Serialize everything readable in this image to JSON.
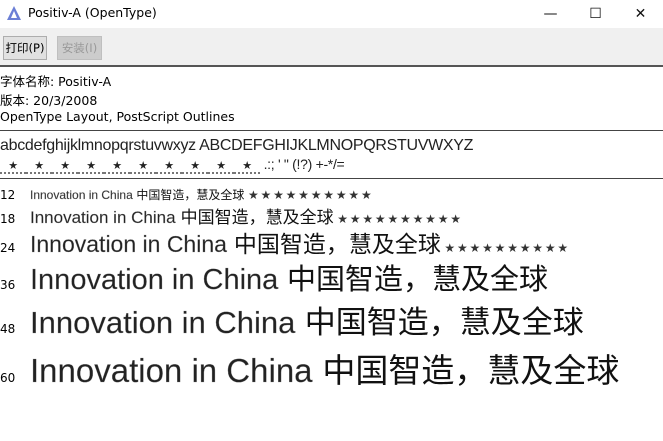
{
  "window": {
    "title": "Positiv-A (OpenType)",
    "minimize": "—",
    "maximize": "☐",
    "close": "✕"
  },
  "toolbar": {
    "print": "打印(P)",
    "install": "安装(I)"
  },
  "info": {
    "name": "字体名称: Positiv-A",
    "version": "版本:  20/3/2008",
    "outlines": "OpenType Layout, PostScript Outlines"
  },
  "charset": {
    "line1": "abcdefghijklmnopqrstuvwxyz  ABCDEFGHIJKLMNOPQRSTUVWXYZ",
    "digits": [
      "★",
      "★",
      "★",
      "★",
      "★",
      "★",
      "★",
      "★",
      "★",
      "★"
    ],
    "punct": ".:;  ' \"  (!?)  +-*/="
  },
  "samples": {
    "latin": "Innovation in China",
    "cjk": "中国智造，慧及全球",
    "stars": "★★★★★★★★★★",
    "rows": [
      {
        "size": "12"
      },
      {
        "size": "18"
      },
      {
        "size": "24"
      },
      {
        "size": "36"
      },
      {
        "size": "48"
      },
      {
        "size": "60"
      }
    ]
  }
}
